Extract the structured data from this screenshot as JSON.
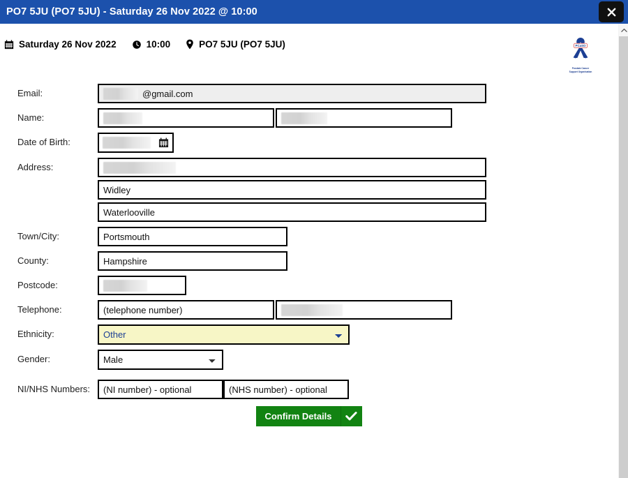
{
  "window": {
    "title": "PO7 5JU (PO7 5JU) - Saturday 26 Nov 2022 @ 10:00",
    "close_label": "close-icon",
    "titlebar_color": "#1c51ac"
  },
  "subheader": {
    "date": "Saturday 26 Nov 2022",
    "time": "10:00",
    "location": "PO7 5JU (PO7 5JU)",
    "date_icon": "calendar-icon",
    "time_icon": "clock-icon",
    "location_icon": "map-pin-icon"
  },
  "logo": {
    "badge_text": "PCaSO",
    "caption_line1": "Prostate Cancer",
    "caption_line2": "Support Organisation",
    "color": "#1b3d8f"
  },
  "form": {
    "email": {
      "label": "Email:",
      "redacted": true,
      "value_suffix": "@gmail.com",
      "readonly": true
    },
    "name": {
      "label": "Name:",
      "first_redacted": true,
      "last_redacted": true,
      "first_placeholder": "",
      "last_placeholder": ""
    },
    "dob": {
      "label": "Date of Birth:",
      "redacted": true,
      "picker_icon": "calendar-icon"
    },
    "address": {
      "label": "Address:",
      "line1_redacted": true,
      "line2": "Widley",
      "line3": "Waterlooville"
    },
    "town": {
      "label": "Town/City:",
      "value": "Portsmouth"
    },
    "county": {
      "label": "County:",
      "value": "Hampshire"
    },
    "postcode": {
      "label": "Postcode:",
      "redacted": true
    },
    "telephone": {
      "label": "Telephone:",
      "placeholder": "(telephone number)",
      "second_redacted": true
    },
    "ethnicity": {
      "label": "Ethnicity:",
      "value": "Other",
      "highlight_color": "#f7f6c6",
      "text_color": "#1c3f94",
      "options": [
        "Other"
      ]
    },
    "gender": {
      "label": "Gender:",
      "value": "Male",
      "options": [
        "Male"
      ]
    },
    "ninhs": {
      "label": "NI/NHS Numbers:",
      "ni_placeholder": "(NI number) - optional",
      "nhs_placeholder": "(NHS number) - optional"
    }
  },
  "submit": {
    "label": "Confirm Details",
    "check_icon": "check-icon",
    "color": "#128312"
  },
  "scrollbar": {
    "up_icon": "chevron-up-icon"
  }
}
